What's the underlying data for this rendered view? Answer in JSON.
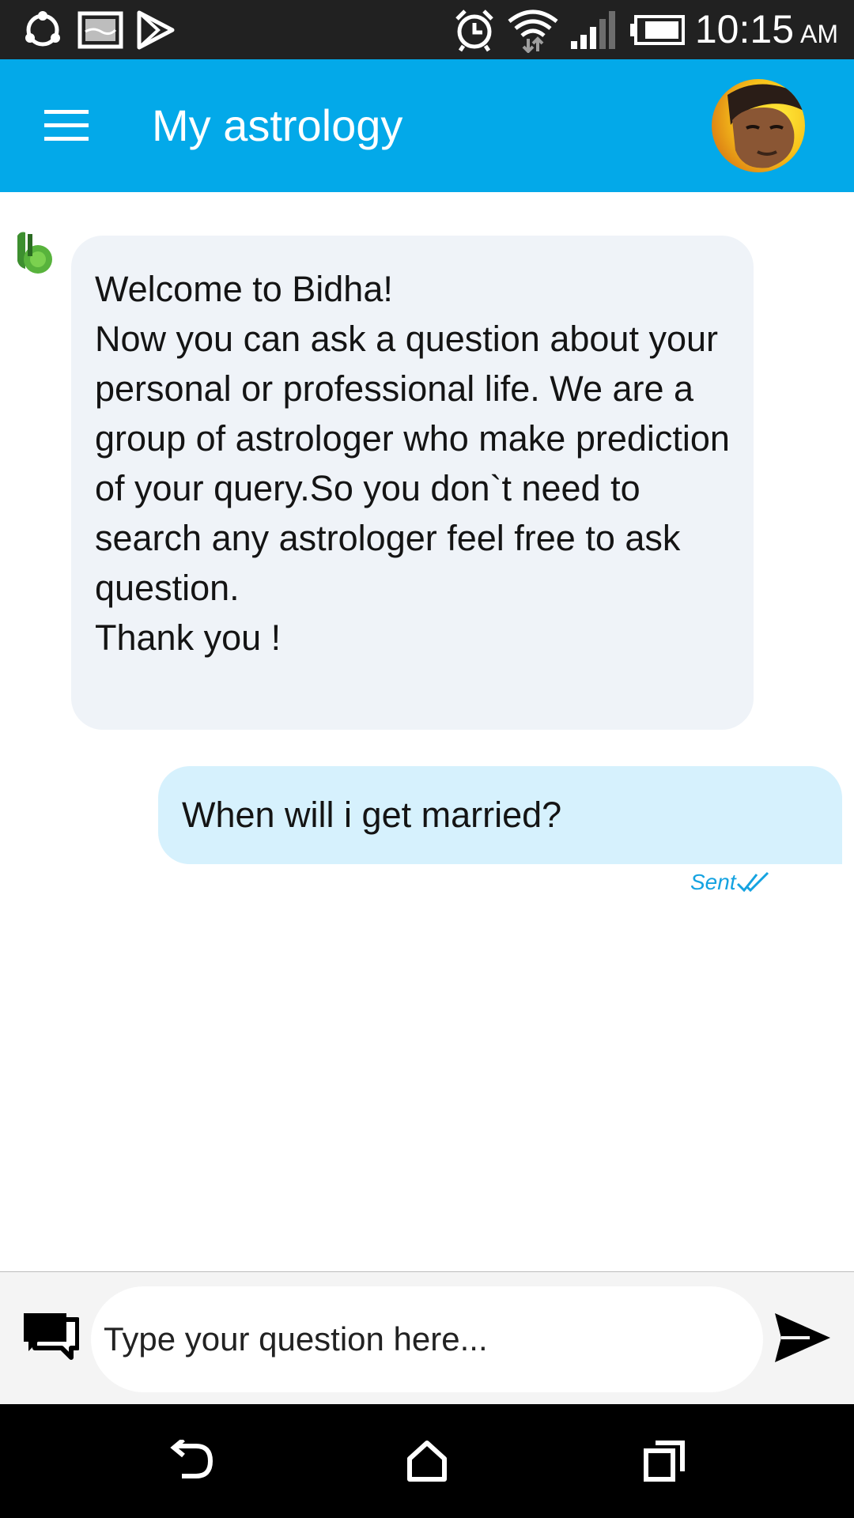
{
  "status_bar": {
    "time": "10:15",
    "ampm": "AM",
    "icons": [
      "shareit-icon",
      "gallery-icon",
      "play-store-icon",
      "alarm-icon",
      "wifi-icon",
      "signal-icon",
      "battery-icon"
    ]
  },
  "app_bar": {
    "title": "My astrology",
    "accent": "#03a9e9"
  },
  "chat": {
    "messages": [
      {
        "direction": "incoming",
        "text": "Welcome to Bidha!\nNow you can ask a question about your personal or professional life. We are a group of astrologer who make prediction of your query.So you don`t need to search any astrologer feel free to ask question.\nThank you !"
      },
      {
        "direction": "outgoing",
        "text": "When will i get married?",
        "status": "Sent"
      }
    ]
  },
  "composer": {
    "placeholder": "Type your question here..."
  },
  "nav_bar": {
    "icons": [
      "back-icon",
      "home-icon",
      "recents-icon"
    ]
  }
}
